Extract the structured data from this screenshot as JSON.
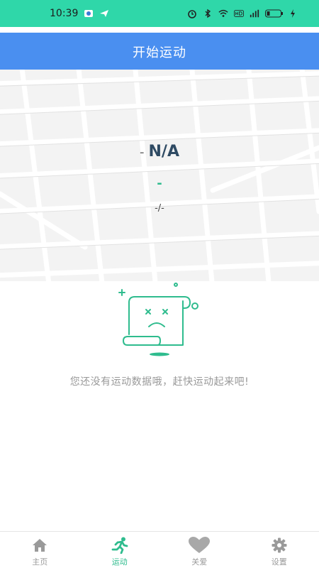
{
  "status_bar": {
    "time": "10:39",
    "background_color": "#2fd7a9"
  },
  "header": {
    "title": "开始运动",
    "background_color": "#4a8ff0"
  },
  "stats": {
    "primary_dash": "-",
    "primary_value": "N/A",
    "secondary_value": "-",
    "ratio": "-/-"
  },
  "empty_state": {
    "message": "您还没有运动数据哦，赶快运动起来吧!",
    "icon": "sad-scroll-icon"
  },
  "bottom_nav": {
    "items": [
      {
        "label": "主页",
        "icon": "home-icon",
        "active": false
      },
      {
        "label": "运动",
        "icon": "running-icon",
        "active": true
      },
      {
        "label": "关爱",
        "icon": "heart-icon",
        "active": false
      },
      {
        "label": "设置",
        "icon": "gear-icon",
        "active": false
      }
    ],
    "active_color": "#2fbc8e"
  }
}
